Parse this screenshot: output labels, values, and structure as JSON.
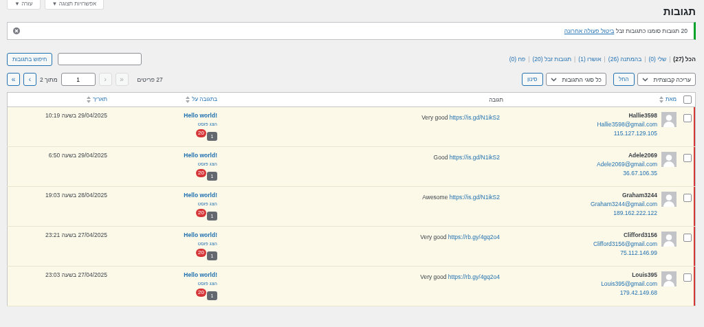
{
  "screen_meta": [
    {
      "label": "אפשרויות תצוגה ▼"
    },
    {
      "label": "עזרה ▼"
    }
  ],
  "title": "תגובות",
  "notice": {
    "text": "20 תגובות סומנו כתגובות זבל",
    "link": "ביטול פעולה אחרונה",
    "kind": "success"
  },
  "filters": [
    {
      "label": "הכל",
      "count": "(27)",
      "selected": true
    },
    {
      "label": "שלי",
      "count": "(0)",
      "selected": false
    },
    {
      "label": "בהמתנה",
      "count": "(26)",
      "selected": false
    },
    {
      "label": "אושרו",
      "count": "(1)",
      "selected": false
    },
    {
      "label": "תגובות זבל",
      "count": "(20)",
      "selected": false
    },
    {
      "label": "פח",
      "count": "(0)",
      "selected": false
    }
  ],
  "filter_separator": "|",
  "search": {
    "button": "חיפוש בתגובות"
  },
  "bulk_action": {
    "value": "עריכה קבוצתית",
    "button": "החל"
  },
  "type_filter": {
    "value": "כל סוגי התגובות",
    "button": "סינון"
  },
  "pagination": {
    "items": "27 פריטים",
    "first": {
      "label": "«",
      "disabled": true
    },
    "prev": {
      "label": "‹",
      "disabled": true
    },
    "page": "1",
    "of": "מתוך 2",
    "next": {
      "label": "›",
      "disabled": false
    },
    "last": {
      "label": "»",
      "disabled": false
    }
  },
  "select_all": {
    "checked": false
  },
  "columns": [
    {
      "label": "מאת",
      "sortable": true
    },
    {
      "label": "תגובה",
      "sortable": false
    },
    {
      "label": "בתגובה על",
      "sortable": true
    },
    {
      "label": "תאריך",
      "sortable": true
    }
  ],
  "rows": [
    {
      "checked": false,
      "unapproved": true,
      "author": "Hallie3598",
      "email": "Hallie3598@gmail.com",
      "ip": "115.127.129.105",
      "comment": "Very good",
      "link": "https://is.gd/N1ikS2",
      "post": "Hello world!",
      "view_post": "הצג פוסט",
      "approved_count": "1",
      "pending_count": "20",
      "date": "29/04/2025 בשעה 10:19"
    },
    {
      "checked": false,
      "unapproved": true,
      "author": "Adele2069",
      "email": "Adele2069@gmail.com",
      "ip": "36.67.106.35",
      "comment": "Good",
      "link": "https://is.gd/N1ikS2",
      "post": "Hello world!",
      "view_post": "הצג פוסט",
      "approved_count": "1",
      "pending_count": "20",
      "date": "29/04/2025 בשעה 6:50"
    },
    {
      "checked": false,
      "unapproved": true,
      "author": "Graham3244",
      "email": "Graham3244@gmail.com",
      "ip": "189.162.222.122",
      "comment": "Awesome",
      "link": "https://is.gd/N1ikS2",
      "post": "Hello world!",
      "view_post": "הצג פוסט",
      "approved_count": "1",
      "pending_count": "20",
      "date": "28/04/2025 בשעה 19:03"
    },
    {
      "checked": false,
      "unapproved": true,
      "author": "Clifford3156",
      "email": "Clifford3156@gmail.com",
      "ip": "75.112.146.99",
      "comment": "Very good",
      "link": "https://rb.gy/4gq2o4",
      "post": "Hello world!",
      "view_post": "הצג פוסט",
      "approved_count": "1",
      "pending_count": "20",
      "date": "27/04/2025 בשעה 23:21"
    },
    {
      "checked": false,
      "unapproved": true,
      "author": "Louis395",
      "email": "Louis395@gmail.com",
      "ip": "179.42.149.68",
      "comment": "Very good",
      "link": "https://rb.gy/4gq2o4",
      "post": "Hello world!",
      "view_post": "הצג פוסט",
      "approved_count": "1",
      "pending_count": "20",
      "date": "27/04/2025 בשעה 23:03"
    }
  ]
}
